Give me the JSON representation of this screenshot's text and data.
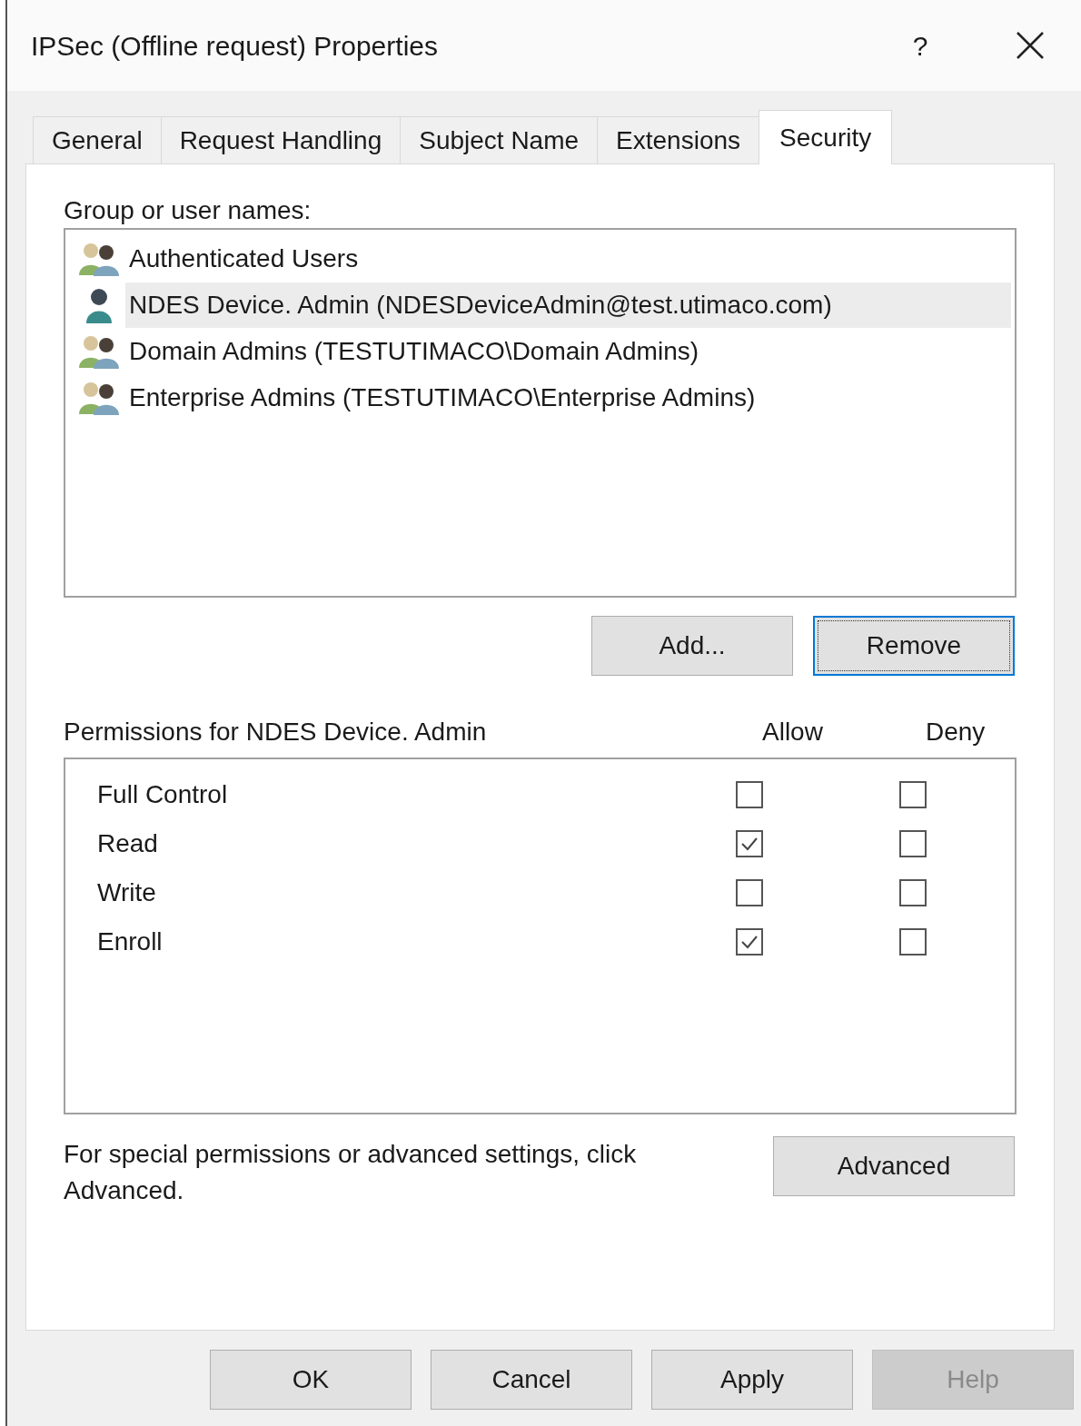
{
  "window": {
    "title": "IPSec (Offline request) Properties",
    "help_label": "?"
  },
  "tabs": [
    {
      "label": "General",
      "selected": false
    },
    {
      "label": "Request Handling",
      "selected": false
    },
    {
      "label": "Subject Name",
      "selected": false
    },
    {
      "label": "Extensions",
      "selected": false
    },
    {
      "label": "Security",
      "selected": true
    }
  ],
  "principals": {
    "label": "Group or user names:",
    "items": [
      {
        "name": "Authenticated Users",
        "kind": "group",
        "selected": false
      },
      {
        "name": "NDES Device. Admin (NDESDeviceAdmin@test.utimaco.com)",
        "kind": "user",
        "selected": true
      },
      {
        "name": "Domain Admins (TESTUTIMACO\\Domain Admins)",
        "kind": "group",
        "selected": false
      },
      {
        "name": "Enterprise Admins (TESTUTIMACO\\Enterprise Admins)",
        "kind": "group",
        "selected": false
      }
    ]
  },
  "list_buttons": [
    {
      "label": "Add...",
      "focused": false
    },
    {
      "label": "Remove",
      "focused": true
    }
  ],
  "permissions": {
    "label": "Permissions for NDES Device. Admin",
    "allow_label": "Allow",
    "deny_label": "Deny",
    "rows": [
      {
        "name": "Full Control",
        "allow": false,
        "deny": false
      },
      {
        "name": "Read",
        "allow": true,
        "deny": false
      },
      {
        "name": "Write",
        "allow": false,
        "deny": false
      },
      {
        "name": "Enroll",
        "allow": true,
        "deny": false
      }
    ]
  },
  "advanced": {
    "text": "For special permissions or advanced settings, click Advanced.",
    "button": "Advanced"
  },
  "footer_buttons": [
    {
      "label": "OK",
      "disabled": false
    },
    {
      "label": "Cancel",
      "disabled": false
    },
    {
      "label": "Apply",
      "disabled": false
    },
    {
      "label": "Help",
      "disabled": true
    }
  ]
}
